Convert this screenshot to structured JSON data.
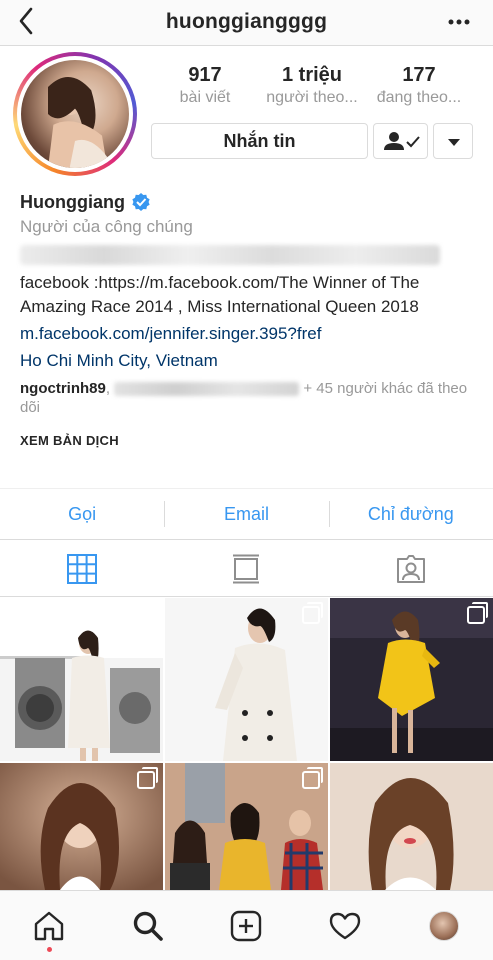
{
  "header": {
    "username": "huonggiangggg"
  },
  "stats": [
    {
      "value": "917",
      "label": "bài viết"
    },
    {
      "value": "1 triệu",
      "label": "người theo..."
    },
    {
      "value": "177",
      "label": "đang theo..."
    }
  ],
  "buttons": {
    "message": "Nhắn tin"
  },
  "bio": {
    "name": "Huonggiang",
    "category": "Người của công chúng",
    "text": "facebook :https://m.facebook.com/The Winner of The Amazing Race 2014 , Miss International Queen 2018",
    "link": "m.facebook.com/jennifer.singer.395?fref",
    "location": "Ho Chi Minh City, Vietnam",
    "followed_by_user": "ngoctrinh89",
    "followed_by_rest": "+ 45 người khác đã theo dõi",
    "translate": "XEM BẢN DỊCH"
  },
  "actions": [
    {
      "label": "Gọi"
    },
    {
      "label": "Email"
    },
    {
      "label": "Chỉ đường"
    }
  ],
  "tabs": [
    "grid-view",
    "feed-view",
    "tagged-view"
  ],
  "bottom_nav": [
    "home-icon",
    "search-icon",
    "new-post-icon",
    "activity-heart-icon",
    "profile-avatar"
  ],
  "colors": {
    "link_blue": "#3897f0",
    "verified_blue": "#3897f0",
    "bio_link": "#003569",
    "notification_dot": "#ed4956"
  }
}
